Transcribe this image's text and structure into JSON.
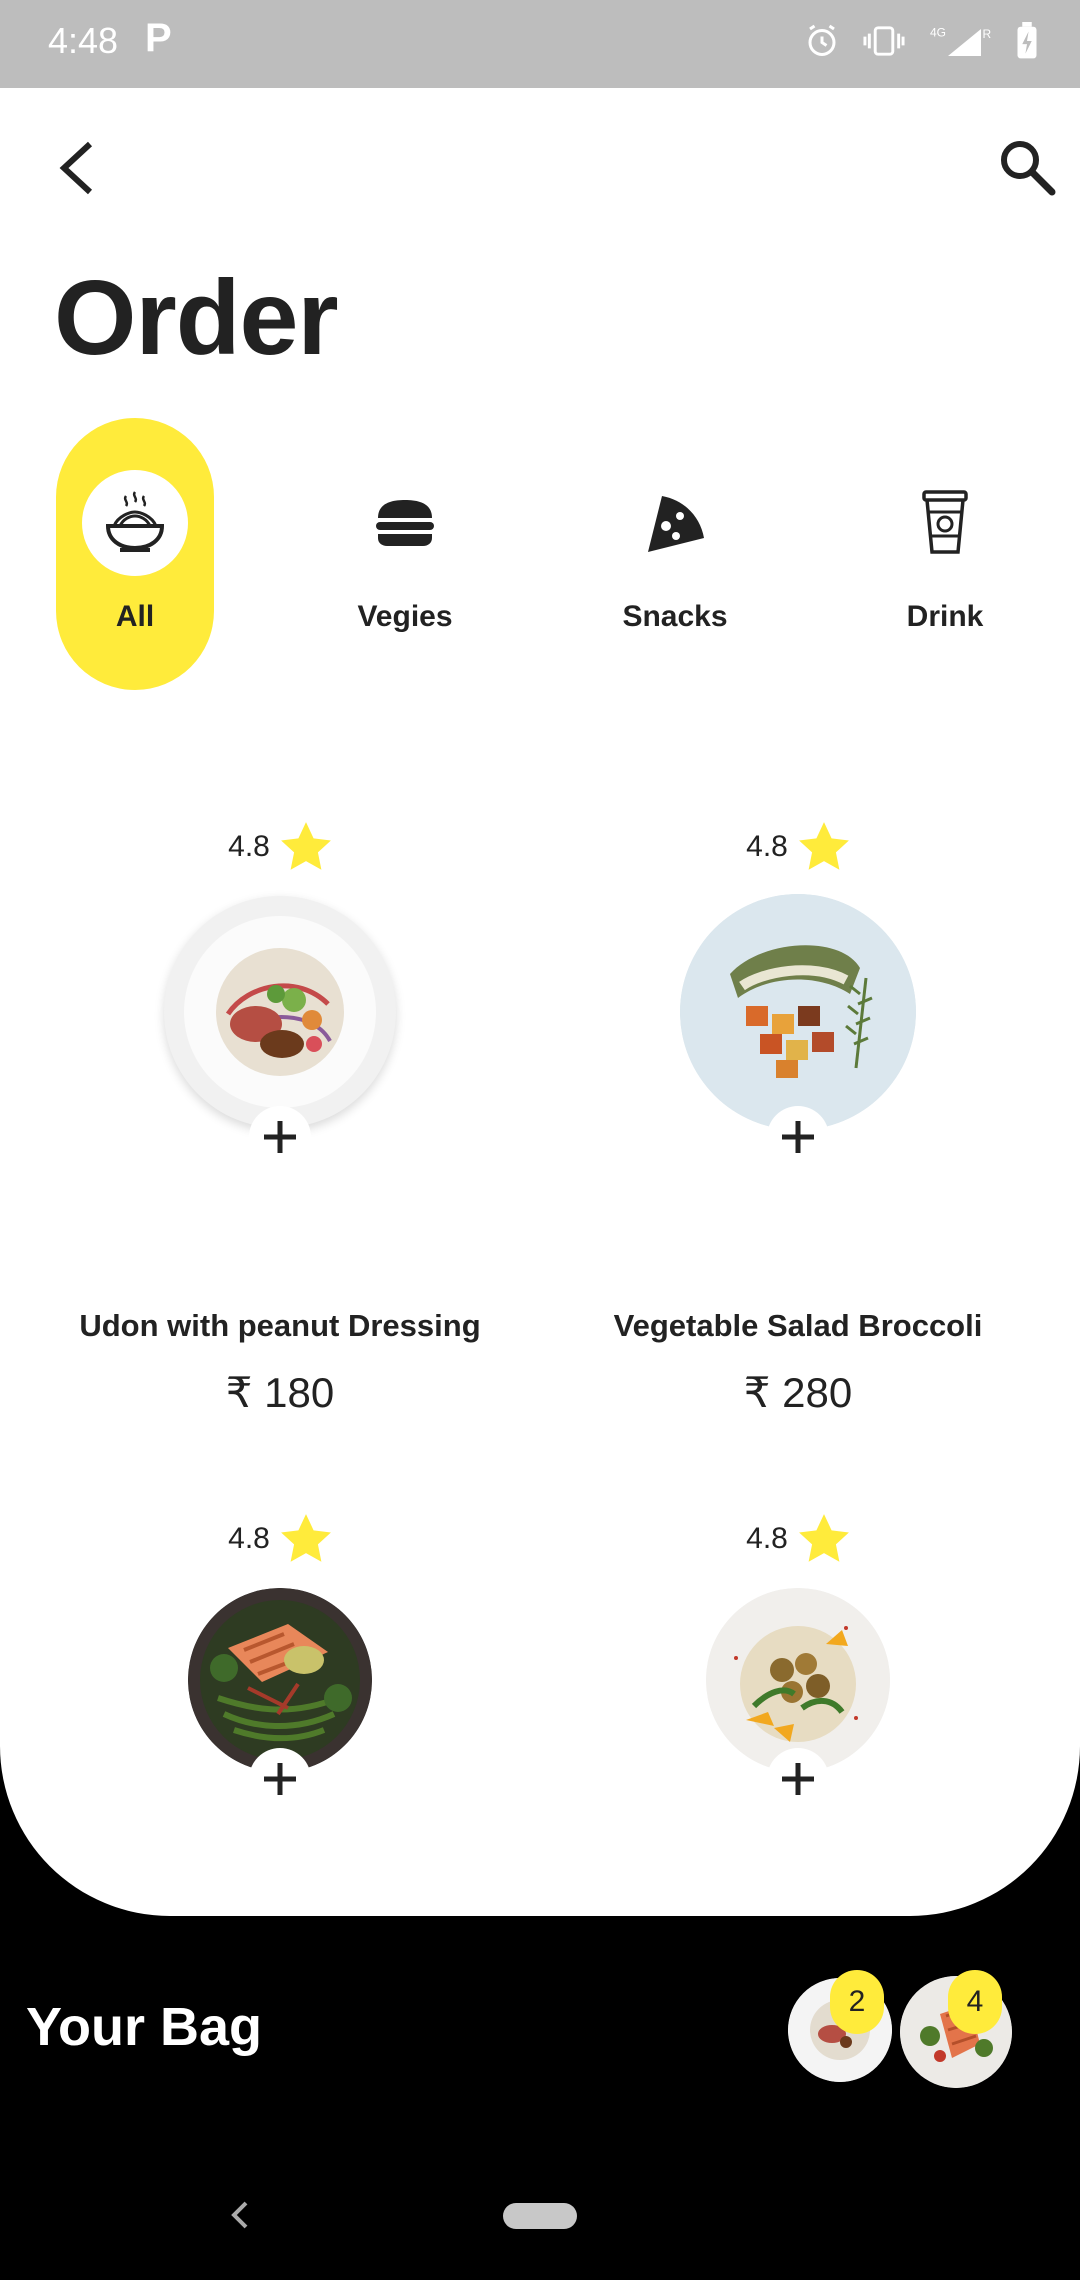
{
  "status_bar": {
    "time": "4:48",
    "carrier_icon": "P"
  },
  "header": {
    "title": "Order"
  },
  "categories": [
    {
      "label": "All",
      "icon": "noodle-bowl-icon",
      "active": true
    },
    {
      "label": "Vegies",
      "icon": "burger-icon",
      "active": false
    },
    {
      "label": "Snacks",
      "icon": "pizza-slice-icon",
      "active": false
    },
    {
      "label": "Drink",
      "icon": "coffee-cup-icon",
      "active": false
    }
  ],
  "items": [
    {
      "name": "Udon with peanut Dressing",
      "price": "₹ 180",
      "rating": "4.8"
    },
    {
      "name": "Vegetable Salad Broccoli",
      "price": "₹ 280",
      "rating": "4.8"
    },
    {
      "name": "",
      "price": "",
      "rating": "4.8"
    },
    {
      "name": "",
      "price": "",
      "rating": "4.8"
    }
  ],
  "bag": {
    "title": "Your Bag",
    "entries": [
      {
        "count": "2"
      },
      {
        "count": "4"
      }
    ]
  },
  "colors": {
    "accent": "#ffeb3b",
    "sheet": "#ffffff",
    "background": "#000000",
    "status_bar": "#bdbdbd"
  }
}
